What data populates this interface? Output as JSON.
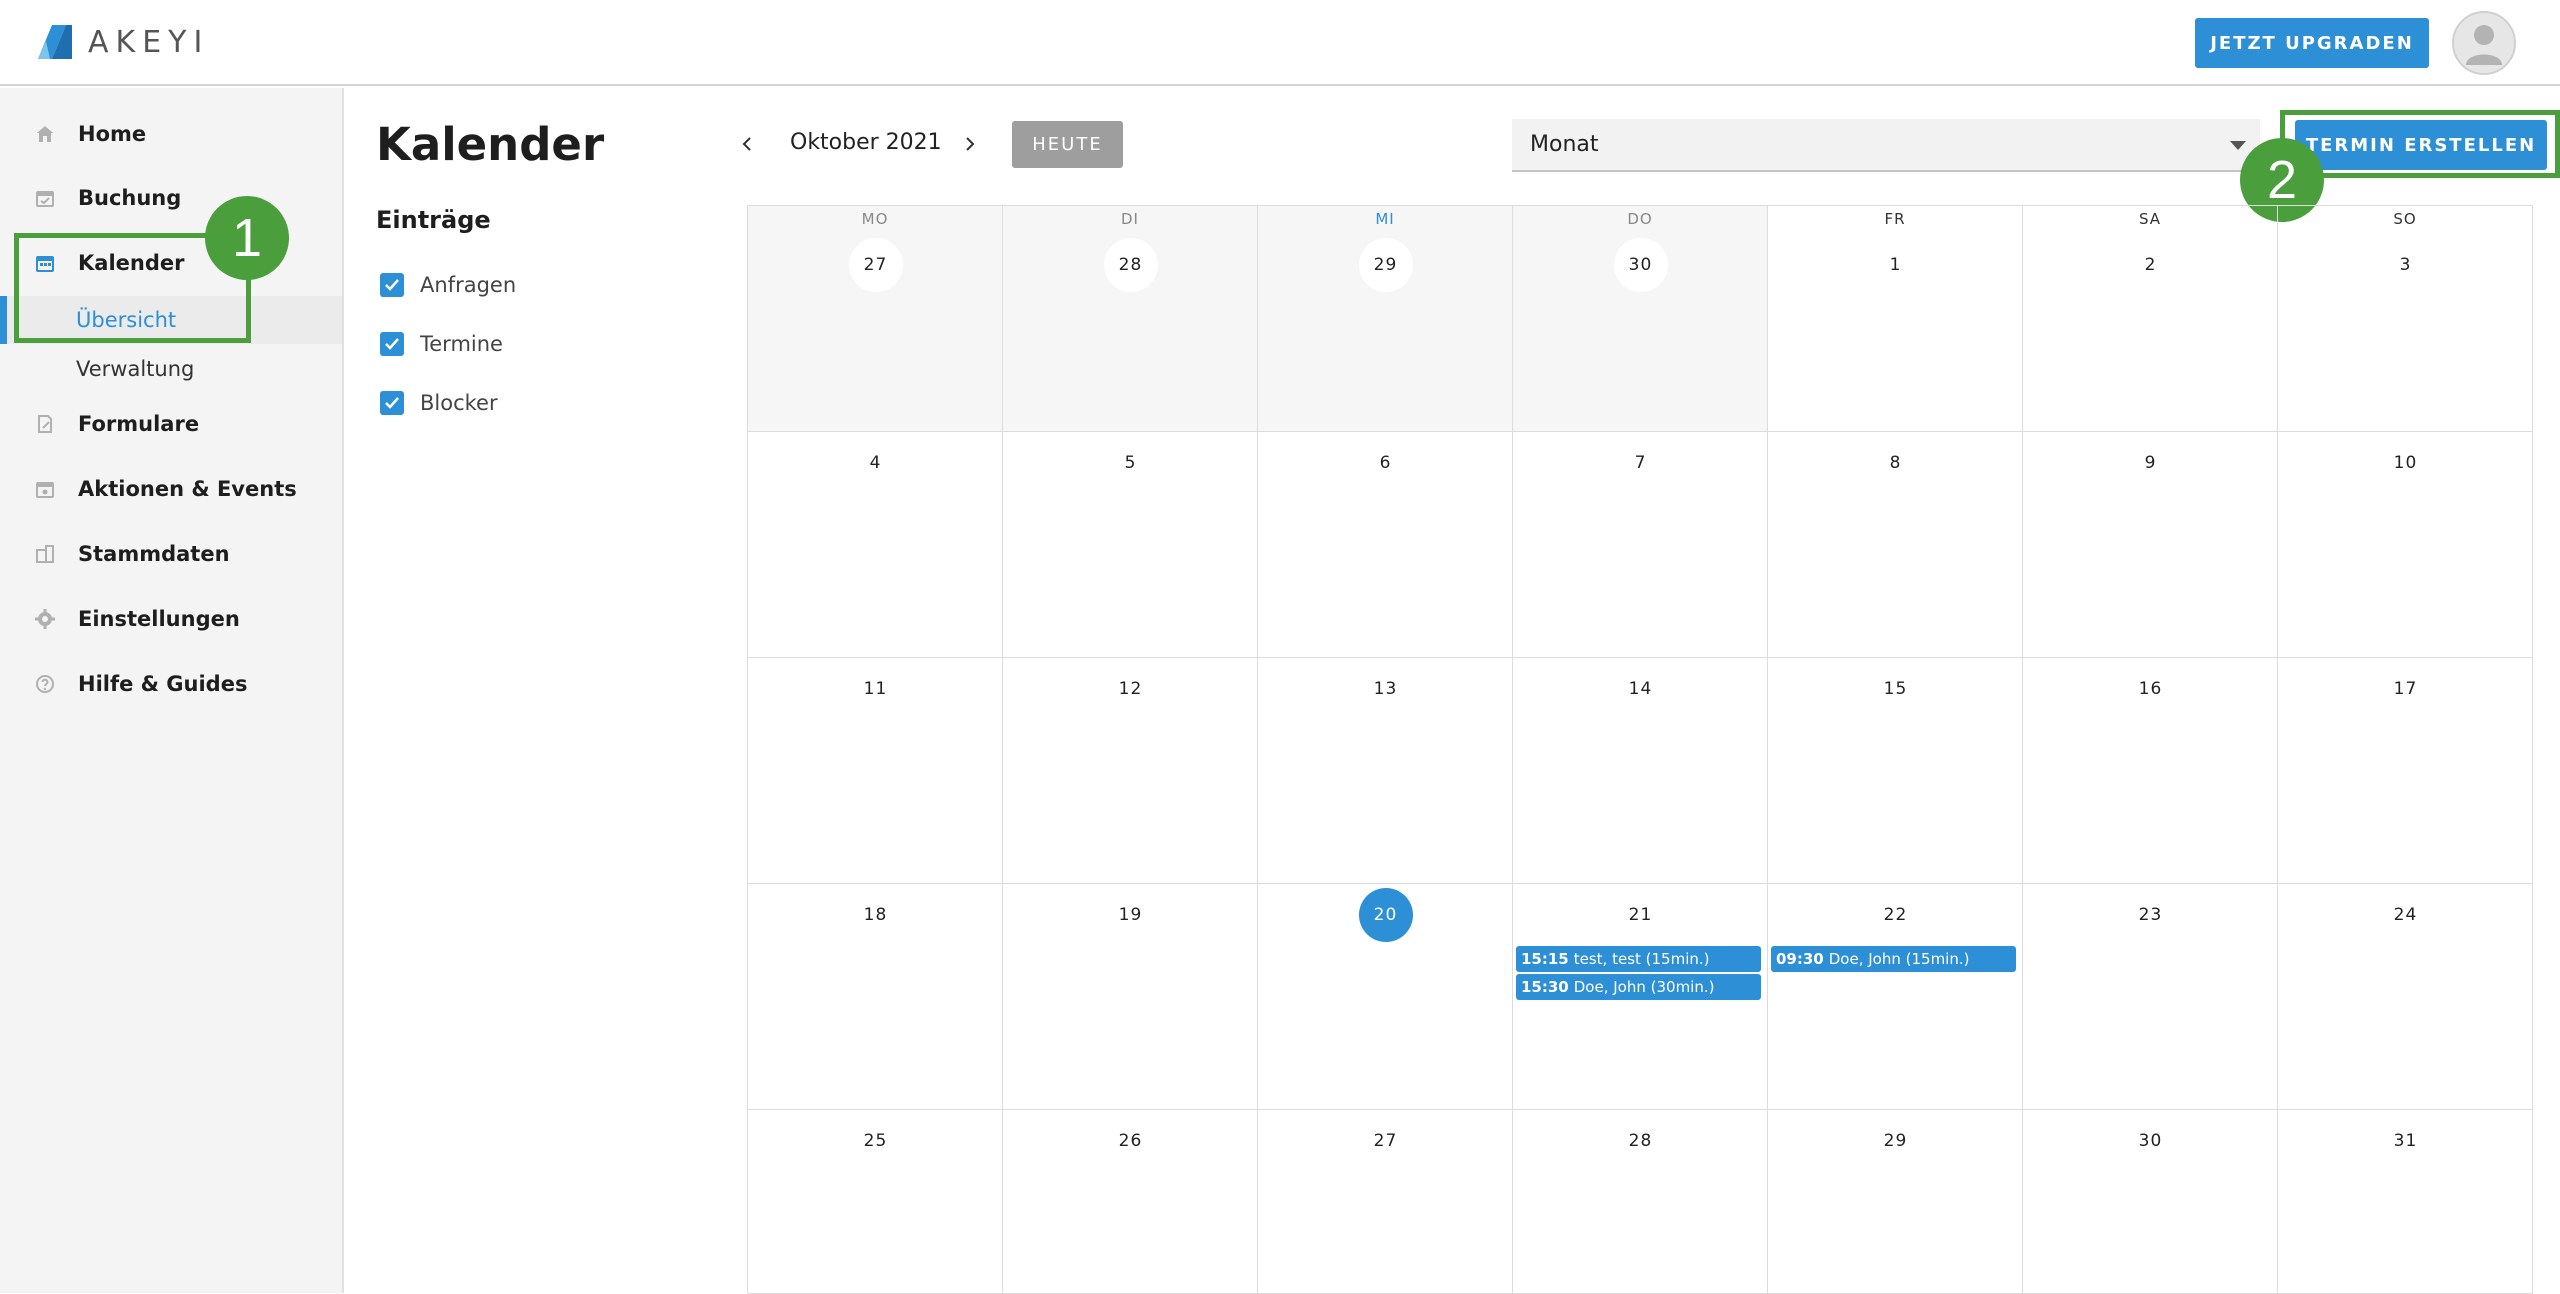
{
  "header": {
    "logo_text": "AKEYI",
    "upgrade_label": "JETZT UPGRADEN",
    "colors": {
      "accent": "#2d8fd5",
      "annotation": "#4b9e3c"
    }
  },
  "sidebar": {
    "items": [
      {
        "label": "Home",
        "icon": "home-icon"
      },
      {
        "label": "Buchung",
        "icon": "calendar-check-icon"
      },
      {
        "label": "Kalender",
        "icon": "calendar-icon"
      },
      {
        "label": "Formulare",
        "icon": "form-edit-icon"
      },
      {
        "label": "Aktionen & Events",
        "icon": "calendar-star-icon"
      },
      {
        "label": "Stammdaten",
        "icon": "building-icon"
      },
      {
        "label": "Einstellungen",
        "icon": "gear-icon"
      },
      {
        "label": "Hilfe & Guides",
        "icon": "help-icon"
      }
    ],
    "subitems": [
      {
        "label": "Übersicht",
        "active": true
      },
      {
        "label": "Verwaltung",
        "active": false
      }
    ]
  },
  "annotations": [
    "1",
    "2"
  ],
  "filters": {
    "page_title": "Kalender",
    "section_title": "Einträge",
    "items": [
      "Anfragen",
      "Termine",
      "Blocker"
    ]
  },
  "toolbar": {
    "month_label": "Oktober 2021",
    "today_label": "HEUTE",
    "view_value": "Monat",
    "create_label": "TERMIN ERSTELLEN"
  },
  "calendar": {
    "weekdays": [
      "MO",
      "DI",
      "MI",
      "DO",
      "FR",
      "SA",
      "SO"
    ],
    "today_weekday_index": 2,
    "weeks": [
      [
        "27",
        "28",
        "29",
        "30",
        "1",
        "2",
        "3"
      ],
      [
        "4",
        "5",
        "6",
        "7",
        "8",
        "9",
        "10"
      ],
      [
        "11",
        "12",
        "13",
        "14",
        "15",
        "16",
        "17"
      ],
      [
        "18",
        "19",
        "20",
        "21",
        "22",
        "23",
        "24"
      ],
      [
        "25",
        "26",
        "27",
        "28",
        "29",
        "30",
        "31"
      ]
    ],
    "past_cells": 4,
    "today": "20",
    "events": [
      {
        "week": 3,
        "day": 3,
        "slot": 0,
        "time": "15:15",
        "text": "test, test (15min.)"
      },
      {
        "week": 3,
        "day": 3,
        "slot": 1,
        "time": "15:30",
        "text": "Doe, John (30min.)"
      },
      {
        "week": 3,
        "day": 4,
        "slot": 0,
        "time": "09:30",
        "text": "Doe, John (15min.)"
      }
    ]
  }
}
